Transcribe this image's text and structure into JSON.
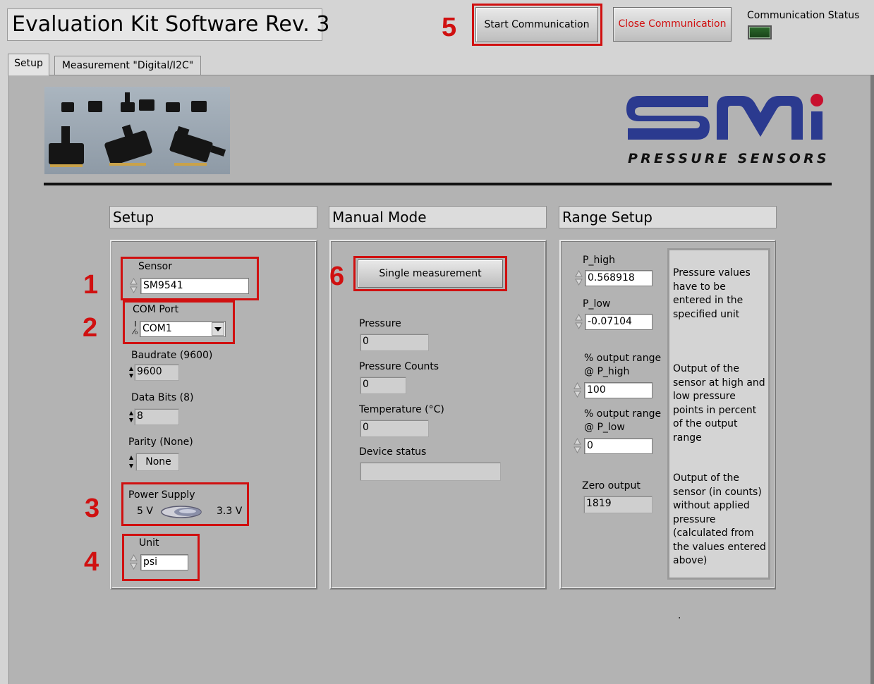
{
  "app": {
    "title": "Evaluation Kit Software Rev. 3"
  },
  "toolbar": {
    "start_label": "Start Communication",
    "close_label": "Close Communication",
    "status_label": "Communication Status",
    "close_color": "#d01010"
  },
  "tabs": [
    {
      "label": "Setup",
      "active": true
    },
    {
      "label": "Measurement \"Digital/I2C\"",
      "active": false
    }
  ],
  "logo": {
    "brand": "SMi",
    "tagline": "PRESSURE SENSORS",
    "brand_color": "#2b3a8f",
    "dot_color": "#c8102e"
  },
  "callouts": [
    "1",
    "2",
    "3",
    "4",
    "5",
    "6"
  ],
  "setup": {
    "header": "Setup",
    "sensor": {
      "label": "Sensor",
      "value": "SM9541"
    },
    "com_port": {
      "label": "COM Port",
      "prefix": "I/o",
      "value": "COM1"
    },
    "baudrate": {
      "label": "Baudrate (9600)",
      "value": "9600"
    },
    "data_bits": {
      "label": "Data Bits (8)",
      "value": "8"
    },
    "parity": {
      "label": "Parity (None)",
      "value": "None"
    },
    "power": {
      "label": "Power Supply",
      "left": "5 V",
      "right": "3.3 V"
    },
    "unit": {
      "label": "Unit",
      "value": "psi"
    }
  },
  "manual": {
    "header": "Manual Mode",
    "button_label": "Single measurement",
    "pressure": {
      "label": "Pressure",
      "value": "0"
    },
    "counts": {
      "label": "Pressure Counts",
      "value": "0"
    },
    "temperature": {
      "label": "Temperature (°C)",
      "value": "0"
    },
    "status": {
      "label": "Device status",
      "value": ""
    }
  },
  "range": {
    "header": "Range Setup",
    "p_high": {
      "label": "P_high",
      "value": "0.568918"
    },
    "p_low": {
      "label": "P_low",
      "value": "-0.07104"
    },
    "out_high": {
      "label1": "% output range",
      "label2": "@ P_high",
      "value": "100"
    },
    "out_low": {
      "label1": "% output range",
      "label2": "@ P_low",
      "value": "0"
    },
    "zero": {
      "label": "Zero output",
      "value": "1819"
    },
    "note1": "Pressure values have to be entered in the specified unit",
    "note2": "Output of the sensor at high and low pressure points in percent of the output range",
    "note3": "Output of the sensor (in counts) without applied pressure (calculated from the values entered above)"
  },
  "misc": {
    "dot": "."
  }
}
